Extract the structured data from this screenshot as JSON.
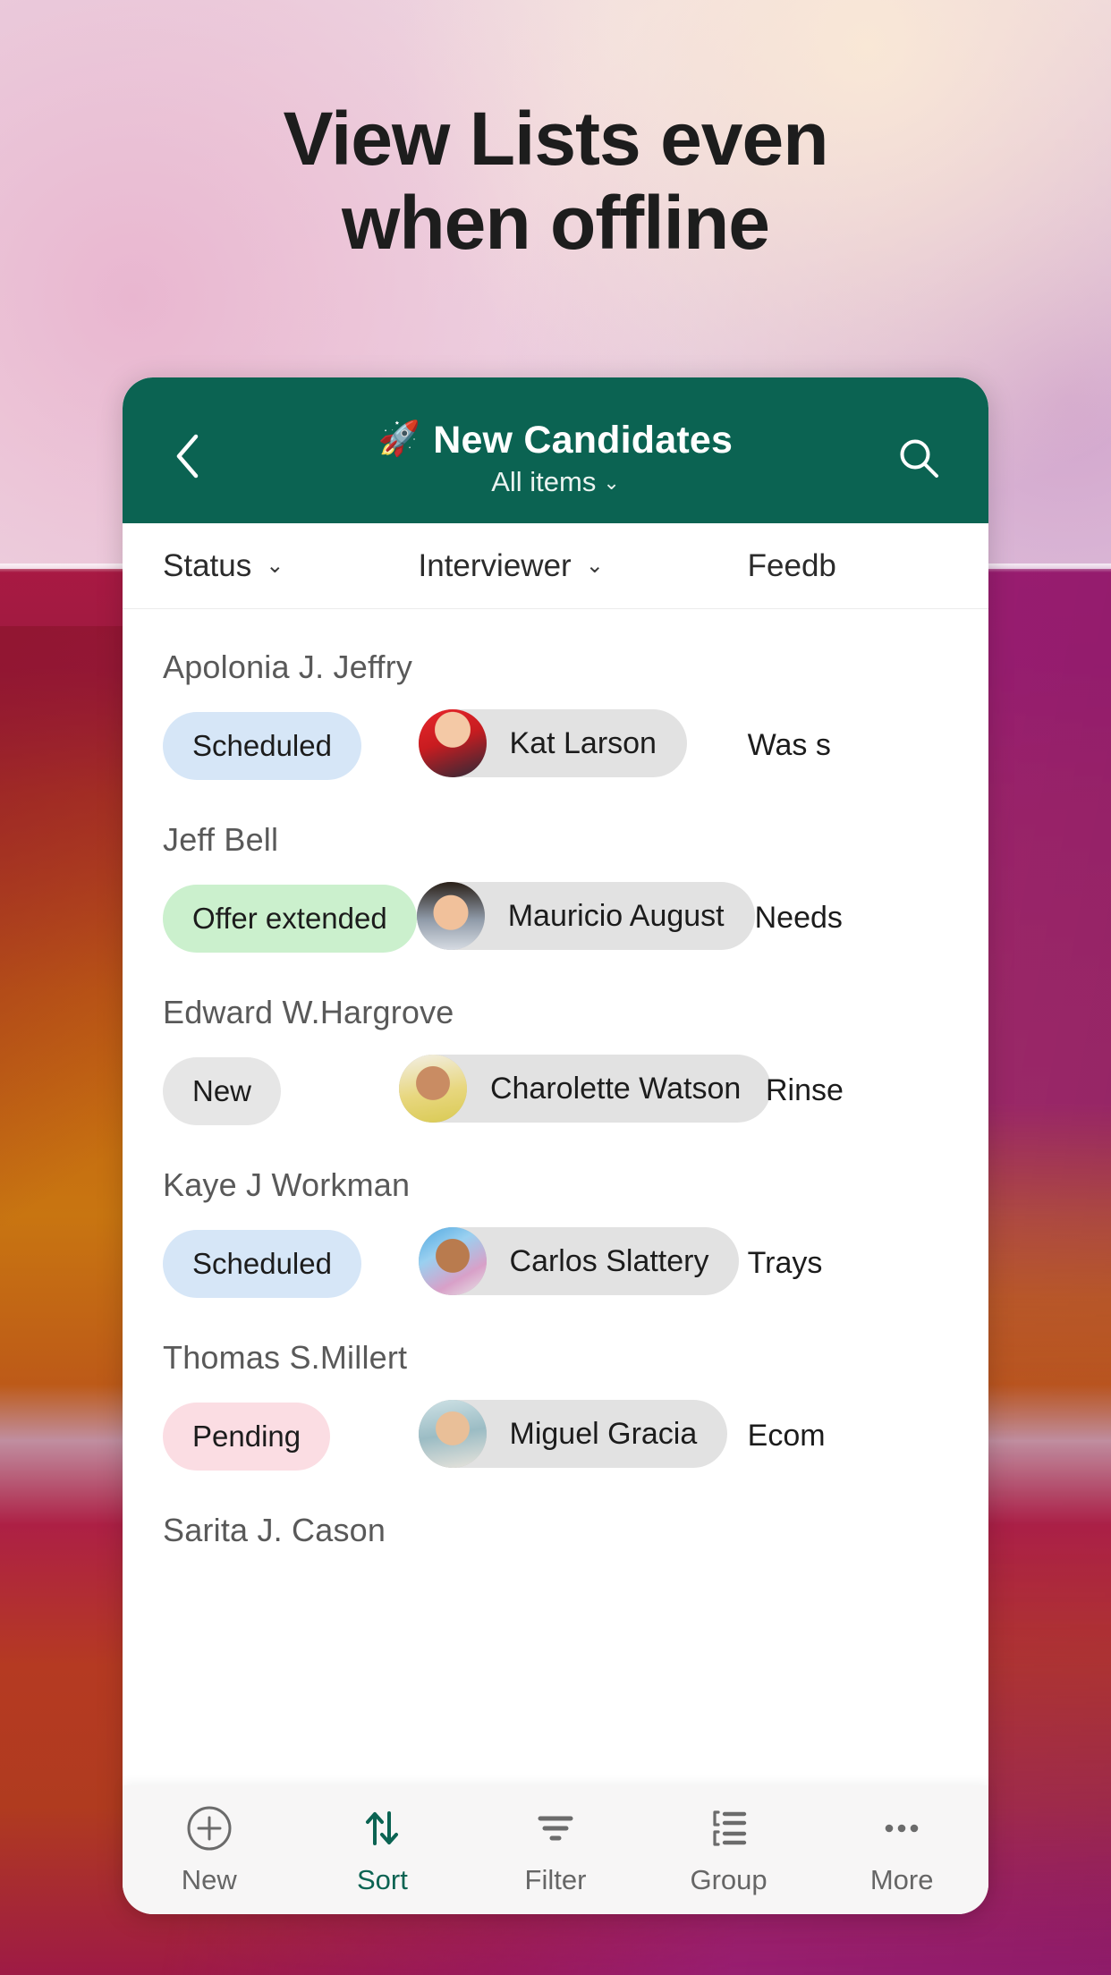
{
  "headline": {
    "line1": "View Lists even",
    "line2": "when offline"
  },
  "navbar": {
    "back_icon": "chevron-left-icon",
    "app_icon": "rocket-icon",
    "title": "New Candidates",
    "subtitle": "All items",
    "subtitle_chevron": "chevron-down-icon",
    "search_icon": "search-icon"
  },
  "columns": {
    "status": "Status",
    "interviewer": "Interviewer",
    "feedback": "Feedb",
    "chevron": "chevron-down-icon"
  },
  "rows": [
    {
      "name": "Apolonia J. Jeffry",
      "status": "Scheduled",
      "status_color": "#d6e6f7",
      "status_class": "blue",
      "interviewer": "Kat Larson",
      "avatar_class": "f1",
      "feedback": "Was s"
    },
    {
      "name": "Jeff Bell",
      "status": "Offer extended",
      "status_color": "#cbf0cd",
      "status_class": "green",
      "interviewer": "Mauricio August",
      "avatar_class": "f2",
      "feedback": "Needs"
    },
    {
      "name": "Edward W.Hargrove",
      "status": "New",
      "status_color": "#e6e6e6",
      "status_class": "grey",
      "interviewer": "Charolette Watson",
      "avatar_class": "f3",
      "feedback": "Rinse"
    },
    {
      "name": "Kaye J Workman",
      "status": "Scheduled",
      "status_color": "#d6e6f7",
      "status_class": "blue",
      "interviewer": "Carlos Slattery",
      "avatar_class": "f4",
      "feedback": "Trays"
    },
    {
      "name": "Thomas S.Millert",
      "status": "Pending",
      "status_color": "#fbdde3",
      "status_class": "pink",
      "interviewer": "Miguel Gracia",
      "avatar_class": "f5",
      "feedback": "Ecom"
    },
    {
      "name": "Sarita J. Cason",
      "status": "",
      "status_color": "#e6e6e6",
      "status_class": "grey",
      "interviewer": "",
      "avatar_class": "f6",
      "feedback": ""
    }
  ],
  "toolbar": {
    "items": [
      {
        "label": "New",
        "icon": "plus-circle-icon",
        "active": false
      },
      {
        "label": "Sort",
        "icon": "sort-arrows-icon",
        "active": true
      },
      {
        "label": "Filter",
        "icon": "filter-icon",
        "active": false
      },
      {
        "label": "Group",
        "icon": "group-list-icon",
        "active": false
      },
      {
        "label": "More",
        "icon": "ellipsis-icon",
        "active": false
      }
    ]
  },
  "theme": {
    "brand_green": "#0b6352",
    "headline_color": "#1d1d1d",
    "card_bg": "#ffffff",
    "toolbar_bg": "#f7f6f6"
  }
}
